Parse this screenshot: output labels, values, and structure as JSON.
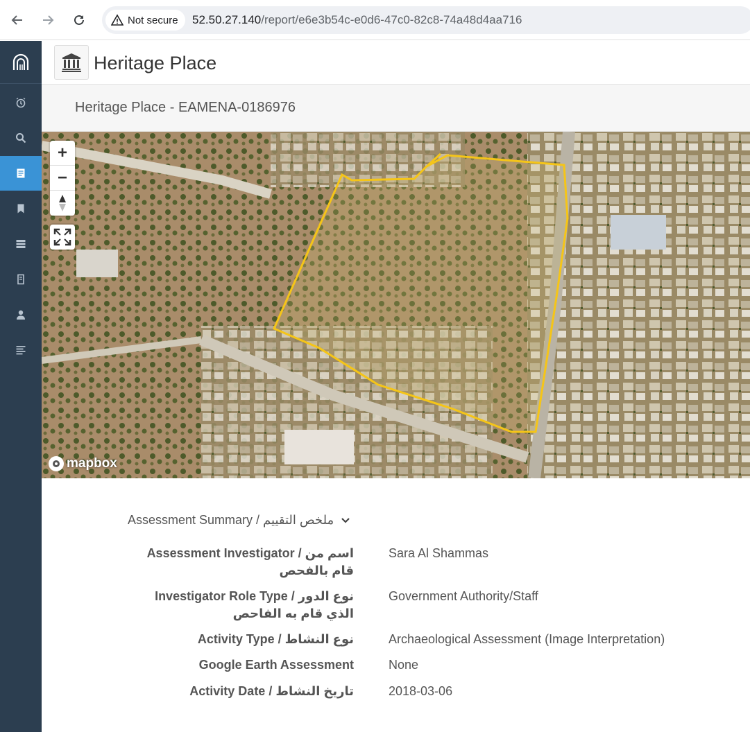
{
  "browser": {
    "security_label": "Not secure",
    "url_host": "52.50.27.140",
    "url_path": "/report/e6e3b54c-e0d6-47c0-82c8-74a48d4aa716"
  },
  "sidebar": {
    "items": [
      {
        "icon": "clock-icon"
      },
      {
        "icon": "search-icon"
      },
      {
        "icon": "report-icon",
        "active": true
      },
      {
        "icon": "bookmark-icon"
      },
      {
        "icon": "database-icon"
      },
      {
        "icon": "document-icon"
      },
      {
        "icon": "user-icon"
      },
      {
        "icon": "list-icon"
      }
    ]
  },
  "header": {
    "title": "Heritage Place",
    "icon": "museum-icon"
  },
  "subheader": {
    "title": "Heritage Place - EAMENA-0186976"
  },
  "map": {
    "zoom_in": "+",
    "zoom_out": "−",
    "attribution": "mapbox",
    "polygon_color": "#f5c518"
  },
  "assessment": {
    "section_title": "Assessment Summary / ملخص التقييم",
    "fields": [
      {
        "label_line1": "Assessment Investigator / اسم من",
        "label_line2": "قام بالفحص",
        "value": "Sara Al Shammas"
      },
      {
        "label_line1": "Investigator Role Type / نوع الدور",
        "label_line2": "الذي قام به الفاحص",
        "value": "Government Authority/Staff"
      },
      {
        "label_line1": "Activity Type / نوع النشاط",
        "label_line2": "",
        "value": "Archaeological Assessment (Image Interpretation)"
      },
      {
        "label_line1": "Google Earth Assessment",
        "label_line2": "",
        "value": "None"
      },
      {
        "label_line1": "Activity Date / تاريخ النشاط",
        "label_line2": "",
        "value": "2018-03-06"
      }
    ]
  }
}
